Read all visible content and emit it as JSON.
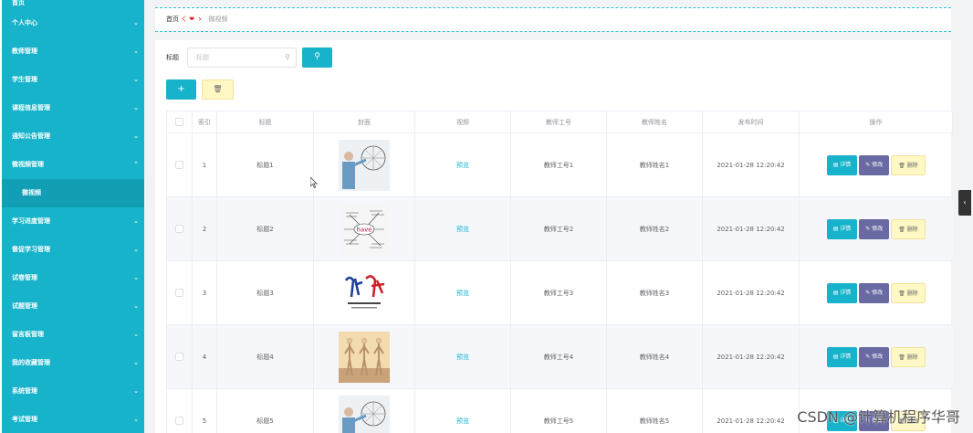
{
  "sidebar": {
    "top_item": "首页",
    "items": [
      {
        "label": "个人中心",
        "arrow": "⌄"
      },
      {
        "label": "教师管理",
        "arrow": "⌄"
      },
      {
        "label": "学生管理",
        "arrow": "⌄"
      },
      {
        "label": "课程信息管理",
        "arrow": "⌄"
      },
      {
        "label": "通知公告管理",
        "arrow": "⌄"
      },
      {
        "label": "微视频管理",
        "arrow": "⌃"
      }
    ],
    "active_sub": "微视频",
    "items_after": [
      {
        "label": "学习进度管理",
        "arrow": "⌄"
      },
      {
        "label": "督促学习管理",
        "arrow": "⌄"
      },
      {
        "label": "试卷管理",
        "arrow": "⌄"
      },
      {
        "label": "试题管理",
        "arrow": "⌄"
      },
      {
        "label": "留言板管理",
        "arrow": "⌄"
      },
      {
        "label": "我的收藏管理",
        "arrow": "⌄"
      },
      {
        "label": "系统管理",
        "arrow": "⌄"
      },
      {
        "label": "考试管理",
        "arrow": "⌄"
      }
    ]
  },
  "breadcrumb": {
    "home": "首页",
    "sep_left": "く",
    "heart": "❤",
    "sep_right": "ゝ",
    "current": "微视频"
  },
  "search": {
    "label": "标题",
    "placeholder": "标题",
    "search_icon": "search-icon"
  },
  "actions": {
    "add_icon": "+",
    "delete_icon": "🗑"
  },
  "table": {
    "headers": [
      "",
      "索引",
      "标题",
      "封面",
      "视频",
      "教师工号",
      "教师姓名",
      "发布时间",
      "操作"
    ],
    "rows": [
      {
        "index": "1",
        "title": "标题1",
        "video": "预览",
        "teacher_no": "教师工号1",
        "teacher_name": "教师姓名1",
        "time": "2021-01-28 12:20:42"
      },
      {
        "index": "2",
        "title": "标题2",
        "video": "预览",
        "teacher_no": "教师工号2",
        "teacher_name": "教师姓名2",
        "time": "2021-01-28 12:20:42"
      },
      {
        "index": "3",
        "title": "标题3",
        "video": "预览",
        "teacher_no": "教师工号3",
        "teacher_name": "教师姓名3",
        "time": "2021-01-28 12:20:42"
      },
      {
        "index": "4",
        "title": "标题4",
        "video": "预览",
        "teacher_no": "教师工号4",
        "teacher_name": "教师姓名4",
        "time": "2021-01-28 12:20:42"
      },
      {
        "index": "5",
        "title": "标题5",
        "video": "预览",
        "teacher_no": "教师工号5",
        "teacher_name": "教师姓名5",
        "time": "2021-01-28 12:20:42"
      }
    ],
    "op_detail": "详情",
    "op_edit": "修改",
    "op_delete": "删除"
  },
  "watermark": "CSDN @计算机程序华哥",
  "colors": {
    "accent": "#17b3cb",
    "edit": "#6a6aa3",
    "delete_bg": "#fff8c5"
  }
}
